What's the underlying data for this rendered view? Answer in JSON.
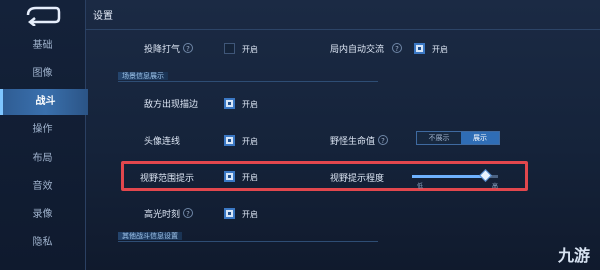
{
  "header": {
    "title": "设置"
  },
  "sidebar": {
    "items": [
      {
        "label": "基础"
      },
      {
        "label": "图像"
      },
      {
        "label": "战斗"
      },
      {
        "label": "操作"
      },
      {
        "label": "布局"
      },
      {
        "label": "音效"
      },
      {
        "label": "录像"
      },
      {
        "label": "隐私"
      }
    ],
    "active_index": 2
  },
  "rows": {
    "touxiang_daqi": {
      "label": "投降打气",
      "checkbox_text": "开启",
      "checked": false
    },
    "junei_jiaoliu": {
      "label": "局内自动交流",
      "checkbox_text": "开启",
      "checked": true
    },
    "section1": "场景信息展示",
    "difang_miaobian": {
      "label": "敌方出现描边",
      "checkbox_text": "开启",
      "checked": true
    },
    "touxiang_lianxian": {
      "label": "头像连线",
      "checkbox_text": "开启",
      "checked": true
    },
    "yeguai_shengming": {
      "label": "野怪生命值",
      "option_off": "不展示",
      "option_on": "展示",
      "selected": "展示"
    },
    "shiye_tishi": {
      "label": "视野范围提示",
      "checkbox_text": "开启",
      "checked": true
    },
    "shiye_chengdu": {
      "label": "视野提示程度",
      "min_label": "低",
      "max_label": "高",
      "value": 0.85
    },
    "gaoguang": {
      "label": "高光时刻",
      "checkbox_text": "开启",
      "checked": true
    },
    "section2": "其他战斗信息设置"
  },
  "watermark": "九游",
  "colors": {
    "accent": "#3b78c4",
    "highlight": "#e2474d"
  }
}
